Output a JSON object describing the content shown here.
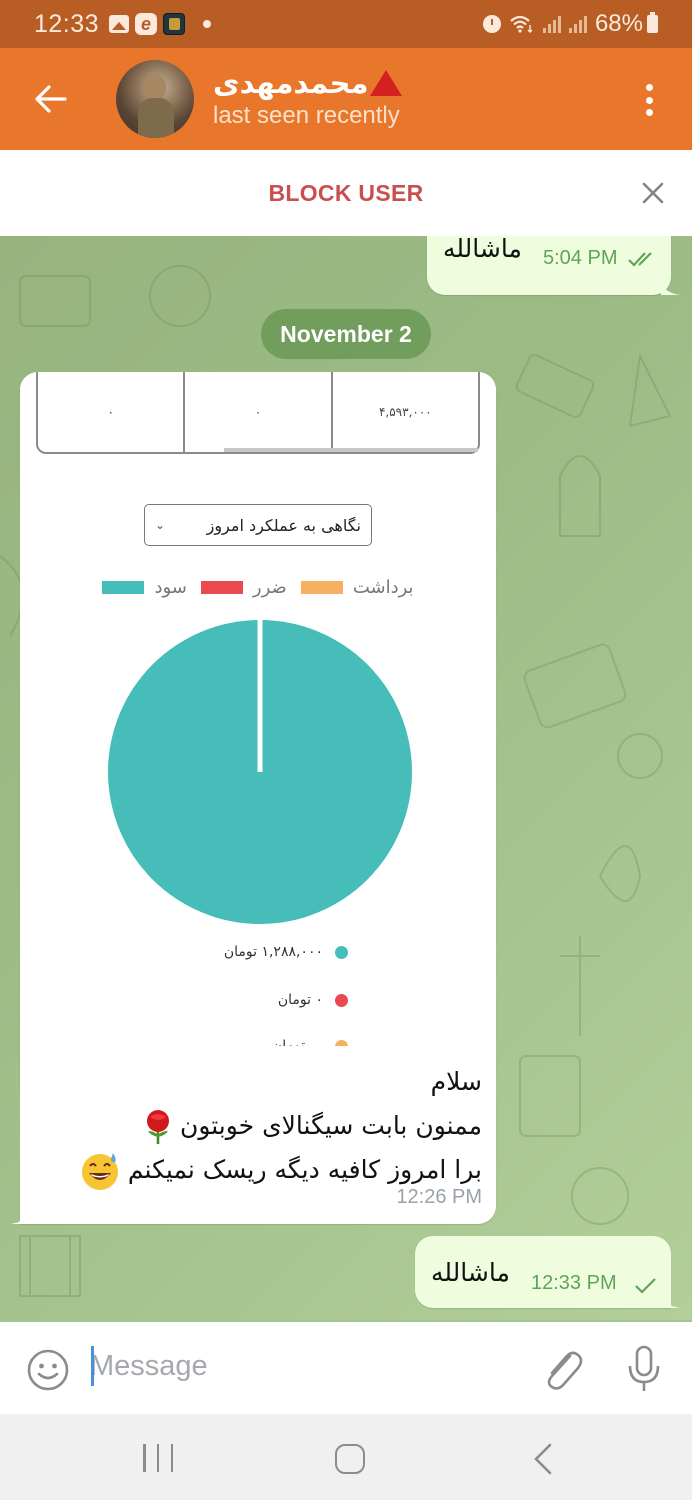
{
  "status_bar": {
    "time": "12:33",
    "battery_percent": "68%",
    "notification_icons": [
      "gallery-icon",
      "e-app-icon",
      "game-app-icon",
      "dot-icon"
    ],
    "system_icons": [
      "alarm-icon",
      "wifi-icon",
      "signal-icon",
      "signal-icon",
      "battery-icon"
    ]
  },
  "header": {
    "contact_name": "محمدمهدی",
    "contact_status": "last seen recently",
    "icons": {
      "back": "arrow-left-icon",
      "menu": "more-vertical-icon",
      "name_badge": "red-triangle-icon"
    },
    "accent_color": "#e9772b"
  },
  "block_bar": {
    "label": "BLOCK USER",
    "close_icon": "close-icon",
    "label_color": "#c84f4f"
  },
  "messages": [
    {
      "type": "outgoing",
      "text": "ماشالله",
      "time": "5:04 PM",
      "status": "read"
    },
    {
      "type": "date",
      "text": "November 2"
    },
    {
      "type": "incoming",
      "has_image": true,
      "lines": [
        "سلام",
        "ممنون بابت سیگنالای خوبتون",
        "برا امروز کافیه دیگه ریسک نمیکنم"
      ],
      "emojis": [
        "rose",
        "grinning-sweat"
      ],
      "time": "12:26 PM"
    },
    {
      "type": "outgoing",
      "text": "ماشالله",
      "time": "12:33 PM",
      "status": "sent"
    }
  ],
  "image_content": {
    "table_cells": [
      "۴,۵۹۳,۰۰۰",
      "۰",
      "۰"
    ],
    "select_value": "نگاهی به عملکرد امروز",
    "select_icon": "chevron-down-icon"
  },
  "chart_data": {
    "type": "pie",
    "title": "",
    "legend_position": "top",
    "legend": [
      {
        "name": "برداشت",
        "color": "#f7b062"
      },
      {
        "name": "ضرر",
        "color": "#ea4a4f"
      },
      {
        "name": "سود",
        "color": "#46bdb9"
      }
    ],
    "series": [
      {
        "name": "سود",
        "value": 1288000,
        "color": "#46bdb9"
      },
      {
        "name": "ضرر",
        "value": 0,
        "color": "#ea4a4f"
      },
      {
        "name": "برداشت",
        "value": 0,
        "color": "#f7b062"
      }
    ],
    "value_labels": [
      "۱,۲۸۸,۰۰۰ تومان",
      "۰ تومان",
      "... تومان"
    ],
    "unit": "تومان"
  },
  "input_bar": {
    "placeholder": "Message",
    "value": "",
    "icons": {
      "emoji": "smiley-icon",
      "attach": "paperclip-icon",
      "voice": "microphone-icon"
    }
  },
  "nav_bar": {
    "icons": [
      "recents-icon",
      "home-icon",
      "back-icon"
    ]
  }
}
